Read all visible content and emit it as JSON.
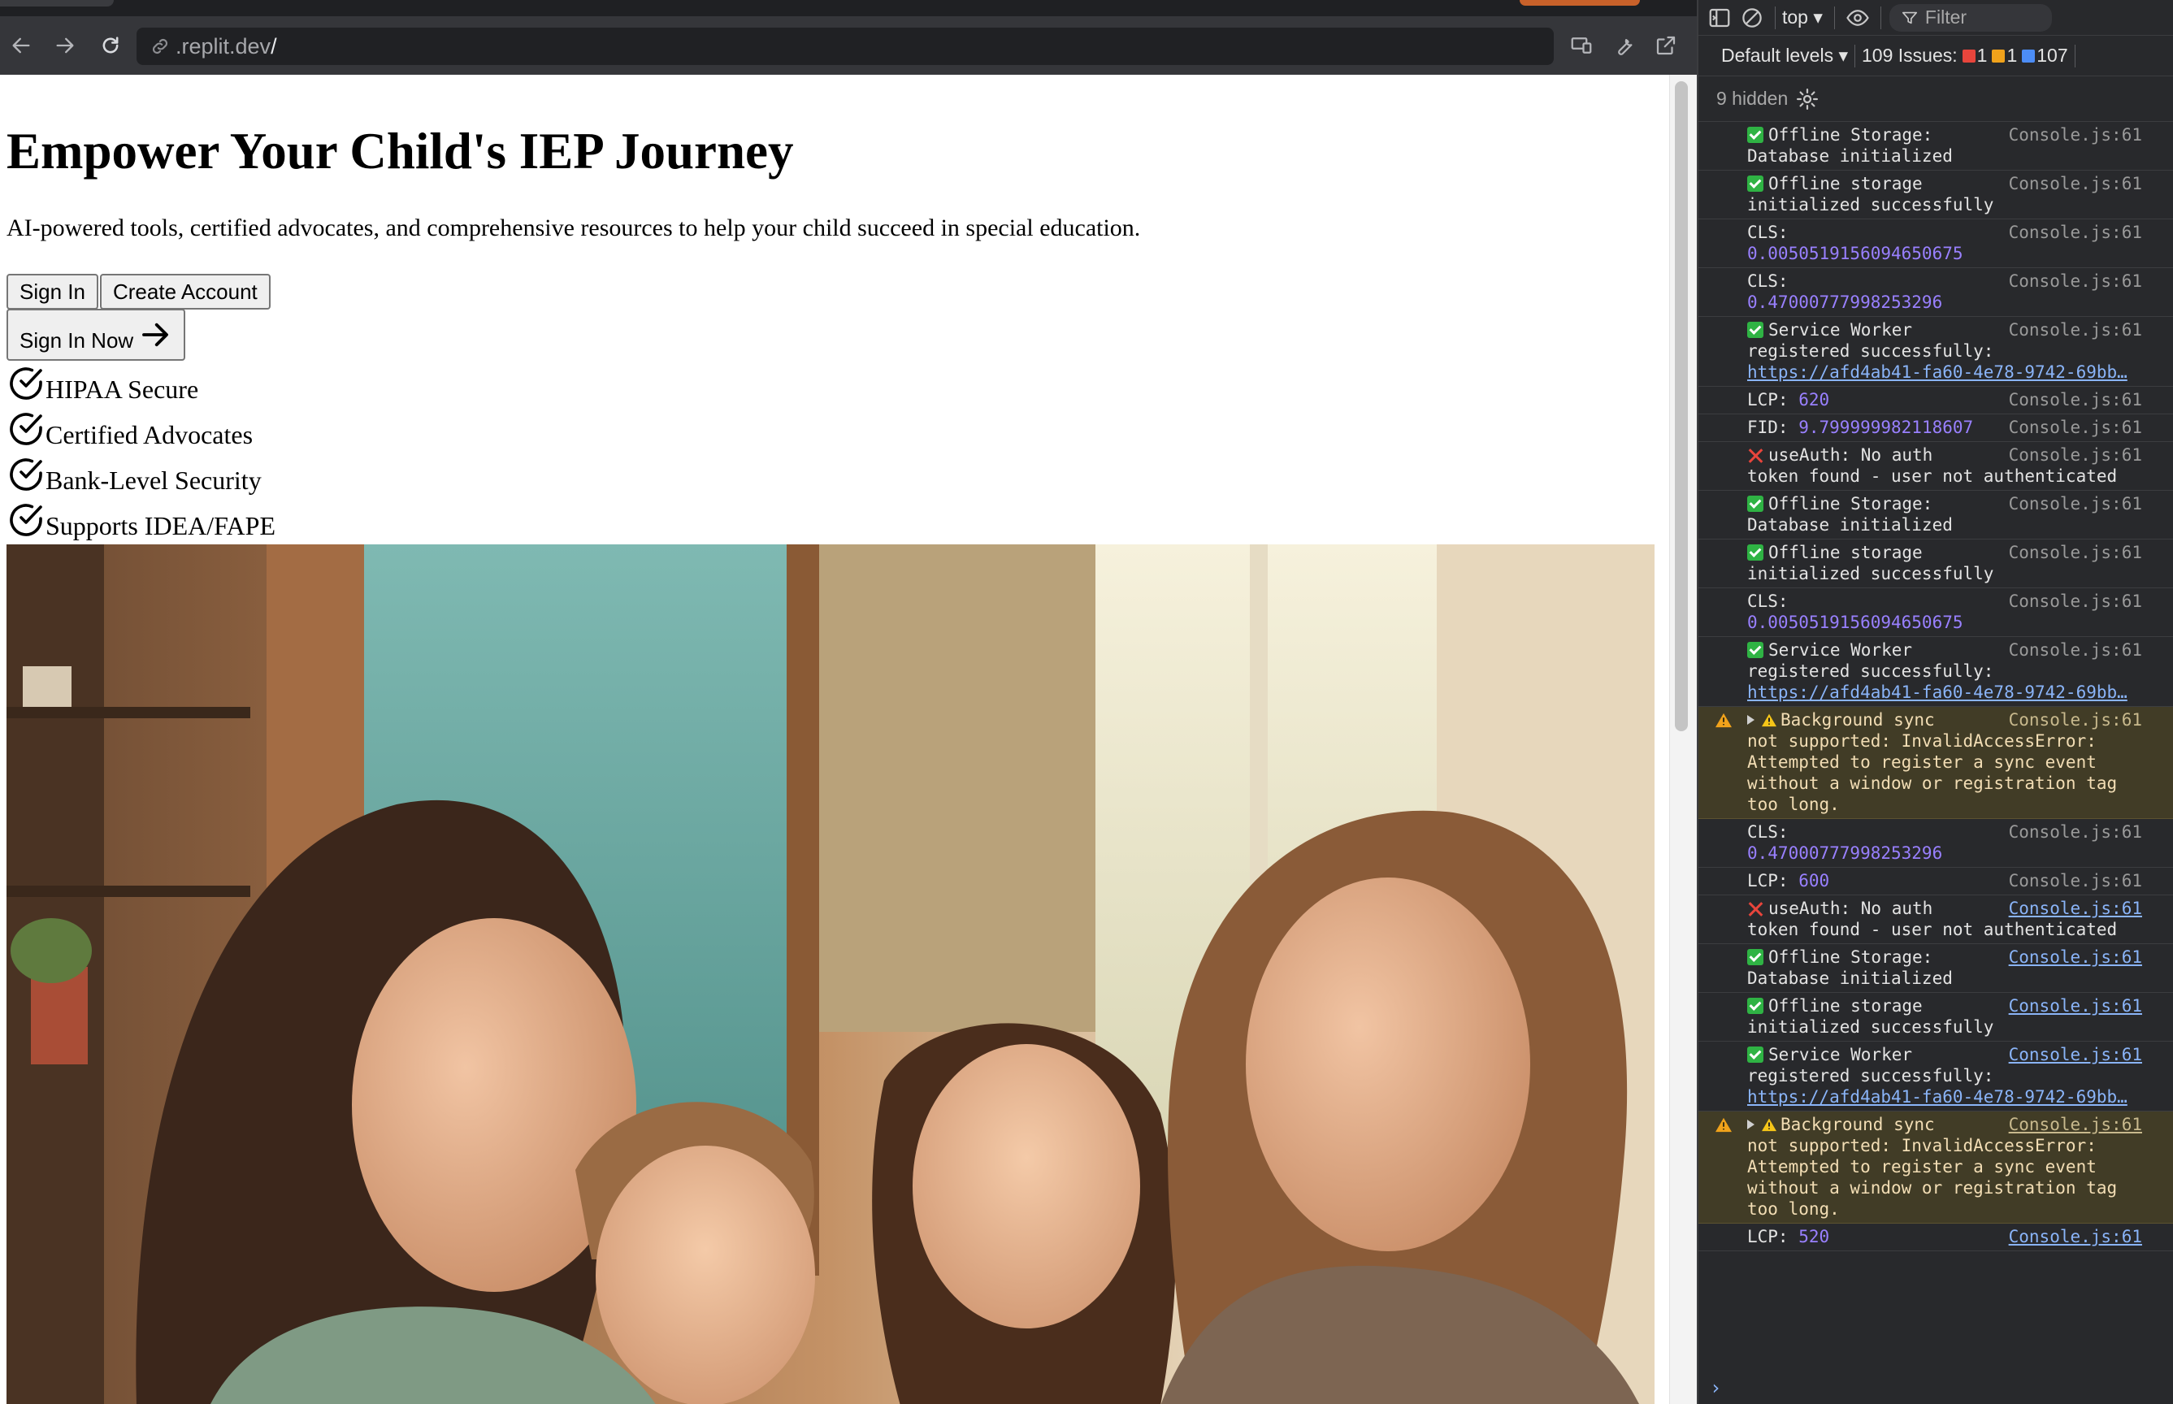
{
  "browser": {
    "url": ".replit.dev",
    "url_caret": "/"
  },
  "page": {
    "title": "Empower Your Child's IEP Journey",
    "subtitle": "AI-powered tools, certified advocates, and comprehensive resources to help your child succeed in special education.",
    "buttons": {
      "sign_in": "Sign In",
      "create_account": "Create Account",
      "sign_in_now": "Sign In Now"
    },
    "features": [
      "HIPAA Secure",
      "Certified Advocates",
      "Bank-Level Security",
      "Supports IDEA/FAPE"
    ]
  },
  "devtools": {
    "context": "top",
    "filter_placeholder": "Filter",
    "levels": "Default levels",
    "issues_label": "109 Issues:",
    "issue_counts": {
      "errors": "1",
      "warnings": "1",
      "info": "107"
    },
    "hidden": "9 hidden",
    "colors": {
      "error": "#e8453c",
      "warning": "#f0a21b",
      "info": "#4c8df6",
      "ok": "#2fb344"
    },
    "messages": [
      {
        "type": "ok",
        "text": "Offline Storage:",
        "text2": "Database initialized",
        "source": "Console.js:61"
      },
      {
        "type": "ok",
        "text": "Offline storage",
        "text2": "initialized successfully",
        "source": "Console.js:61"
      },
      {
        "type": "metric",
        "text": "CLS:",
        "value": "0.0050519156094650675",
        "source": "Console.js:61"
      },
      {
        "type": "metric",
        "text": "CLS:",
        "value": "0.47000777998253296",
        "source": "Console.js:61"
      },
      {
        "type": "ok",
        "text": "Service Worker",
        "text2": "registered successfully:",
        "url": "https://afd4ab41-fa60-4e78-9742-69bb…",
        "source": "Console.js:61"
      },
      {
        "type": "inline",
        "text": "LCP:",
        "value": "620",
        "source": "Console.js:61"
      },
      {
        "type": "inline",
        "text": "FID:",
        "value": "9.799999982118607",
        "source": "Console.js:61"
      },
      {
        "type": "err",
        "text": "useAuth: No auth",
        "text2": "token found - user not authenticated",
        "source": "Console.js:61"
      },
      {
        "type": "ok",
        "text": "Offline Storage:",
        "text2": "Database initialized",
        "source": "Console.js:61"
      },
      {
        "type": "ok",
        "text": "Offline storage",
        "text2": "initialized successfully",
        "source": "Console.js:61"
      },
      {
        "type": "metric",
        "text": "CLS:",
        "value": "0.0050519156094650675",
        "source": "Console.js:61"
      },
      {
        "type": "ok",
        "text": "Service Worker",
        "text2": "registered successfully:",
        "url": "https://afd4ab41-fa60-4e78-9742-69bb…",
        "source": "Console.js:61"
      },
      {
        "type": "warn",
        "text": "Background sync",
        "rest": [
          "not supported: InvalidAccessError:",
          "Attempted to register a sync event",
          "without a window or registration tag",
          "too long."
        ],
        "source": "Console.js:61"
      },
      {
        "type": "metric",
        "text": "CLS:",
        "value": "0.47000777998253296",
        "source": "Console.js:61"
      },
      {
        "type": "inline",
        "text": "LCP:",
        "value": "600",
        "source": "Console.js:61"
      },
      {
        "type": "err",
        "text": "useAuth: No auth",
        "text2": "token found - user not authenticated",
        "source": "Console.js:61",
        "link": true
      },
      {
        "type": "ok",
        "text": "Offline Storage:",
        "text2": "Database initialized",
        "source": "Console.js:61",
        "link": true
      },
      {
        "type": "ok",
        "text": "Offline storage",
        "text2": "initialized successfully",
        "source": "Console.js:61",
        "link": true
      },
      {
        "type": "ok",
        "text": "Service Worker",
        "text2": "registered successfully:",
        "url": "https://afd4ab41-fa60-4e78-9742-69bb…",
        "source": "Console.js:61",
        "link": true
      },
      {
        "type": "warn",
        "text": "Background sync",
        "rest": [
          "not supported: InvalidAccessError:",
          "Attempted to register a sync event",
          "without a window or registration tag",
          "too long."
        ],
        "source": "Console.js:61",
        "link": true
      },
      {
        "type": "inline",
        "text": "LCP:",
        "value": "520",
        "source": "Console.js:61",
        "link": true
      }
    ]
  }
}
